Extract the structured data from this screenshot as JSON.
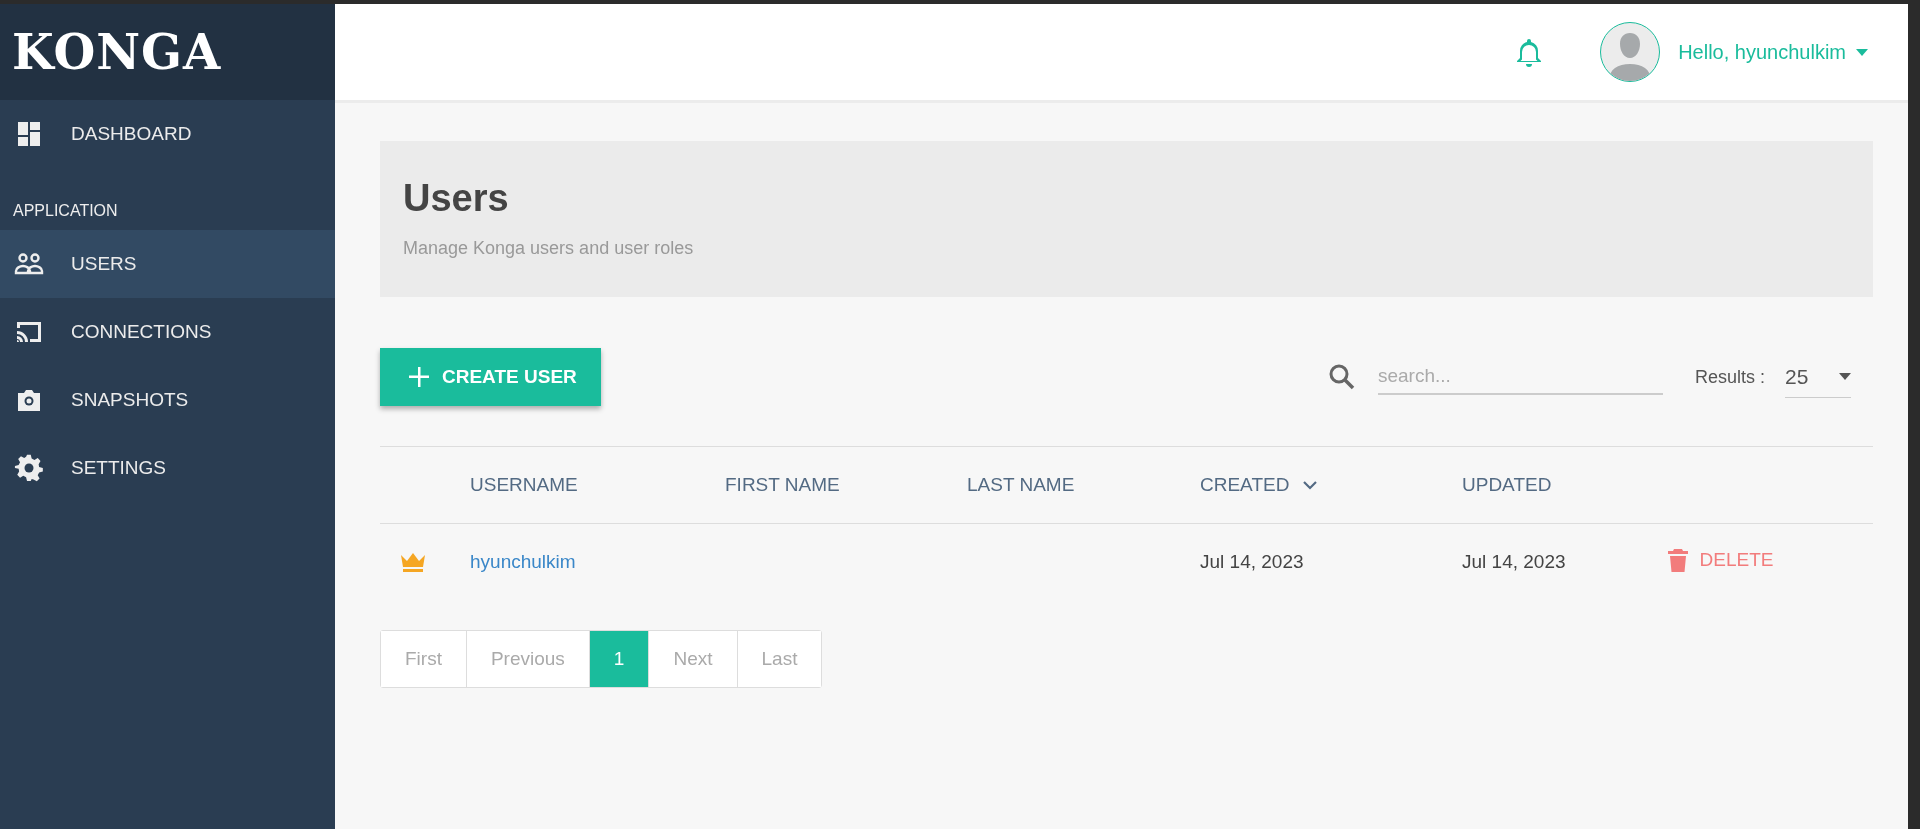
{
  "sidebar": {
    "logo": "KONGA",
    "items": [
      {
        "kind": "link",
        "label": "DASHBOARD",
        "selected": false
      },
      {
        "kind": "section",
        "label": "APPLICATION"
      },
      {
        "kind": "link",
        "label": "USERS",
        "selected": true
      },
      {
        "kind": "link",
        "label": "CONNECTIONS",
        "selected": false
      },
      {
        "kind": "link",
        "label": "SNAPSHOTS",
        "selected": false
      },
      {
        "kind": "link",
        "label": "SETTINGS",
        "selected": false
      }
    ]
  },
  "header": {
    "greeting": "Hello, hyunchulkim"
  },
  "page_header": {
    "title": "Users",
    "subtitle": "Manage Konga users and user roles"
  },
  "toolbar": {
    "create_button": "CREATE USER",
    "search": {
      "placeholder": "search..."
    },
    "results_label": "Results :",
    "results_value": "25"
  },
  "table": {
    "columns": [
      {
        "label": "USERNAME",
        "sorted": false
      },
      {
        "label": "FIRST NAME",
        "sorted": false
      },
      {
        "label": "LAST NAME",
        "sorted": false
      },
      {
        "label": "CREATED",
        "sorted": true
      },
      {
        "label": "UPDATED",
        "sorted": false
      }
    ],
    "rows": [
      {
        "admin": true,
        "username": "hyunchulkim",
        "created": "Jul 14, 2023",
        "updated": "Jul 14, 2023",
        "action": "DELETE"
      }
    ]
  },
  "pagination": [
    {
      "label": "First",
      "selected": false
    },
    {
      "label": "Previous",
      "selected": false
    },
    {
      "label": "1",
      "selected": true
    },
    {
      "label": "Next",
      "selected": false
    },
    {
      "label": "Last",
      "selected": false
    }
  ]
}
